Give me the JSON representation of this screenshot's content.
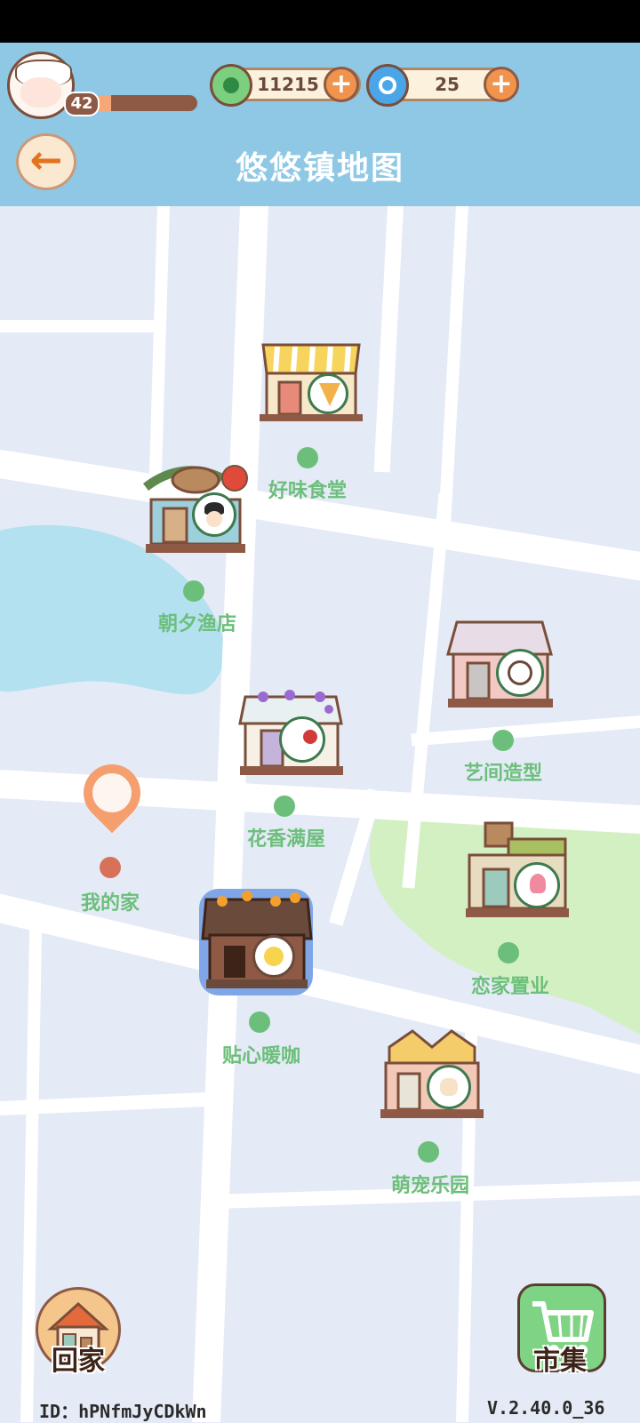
{
  "header": {
    "level": "42",
    "xp_progress": 0.18,
    "clover_count": "11215",
    "swirl_count": "25",
    "title": "悠悠镇地图",
    "back_icon": "arrow-left-icon"
  },
  "map": {
    "shops": [
      {
        "id": "haowei",
        "label": "好味食堂",
        "badge_icon": "pizza-icon"
      },
      {
        "id": "zhaoxi",
        "label": "朝夕渔店",
        "badge_icon": "fisherman-icon"
      },
      {
        "id": "yijian",
        "label": "艺间造型",
        "badge_icon": "stylist-icon"
      },
      {
        "id": "huaxiang",
        "label": "花香满屋",
        "badge_icon": "rose-icon"
      },
      {
        "id": "lianjia",
        "label": "恋家置业",
        "badge_icon": "lotus-icon"
      },
      {
        "id": "tiexin",
        "label": "贴心暖咖",
        "badge_icon": "sunny-egg-icon"
      },
      {
        "id": "mengchong",
        "label": "萌宠乐园",
        "badge_icon": "cat-icon"
      }
    ],
    "home_label": "我的家"
  },
  "footer": {
    "home_button": "回家",
    "market_button": "市集",
    "user_id": "ID：hPNfmJyCDkWn",
    "version": "V.2.40.0_36"
  },
  "colors": {
    "header_bg": "#8ec8e5",
    "map_bg": "#e4eaf6",
    "road": "#ffffff",
    "lake": "#b3e1ef",
    "park": "#d3f0c2",
    "label_green": "#6cbf7a"
  }
}
